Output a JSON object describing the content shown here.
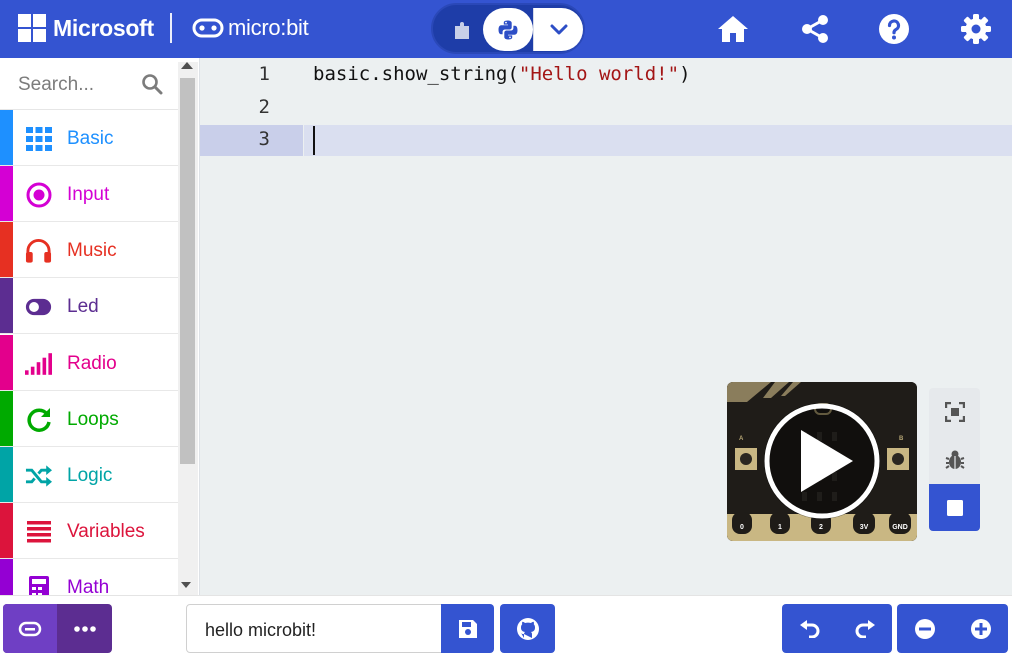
{
  "header": {
    "brand": "Microsoft",
    "product": "micro:bit",
    "mode_icons": [
      "puzzle-icon",
      "python-icon",
      "chevron-down-icon"
    ],
    "action_icons": [
      "home-icon",
      "share-icon",
      "help-icon",
      "gear-icon"
    ],
    "colors": {
      "bar": "#3454d1",
      "switch": "#1e3da8"
    }
  },
  "sidebar": {
    "search_placeholder": "Search...",
    "categories": [
      {
        "label": "Basic",
        "color": "#1e90ff",
        "icon": "grid-icon"
      },
      {
        "label": "Input",
        "color": "#d400d4",
        "icon": "target-icon"
      },
      {
        "label": "Music",
        "color": "#e63022",
        "icon": "headphones-icon"
      },
      {
        "label": "Led",
        "color": "#5c2d91",
        "icon": "toggle-icon"
      },
      {
        "label": "Radio",
        "color": "#e3008c",
        "icon": "signal-bars-icon"
      },
      {
        "label": "Loops",
        "color": "#00aa00",
        "icon": "refresh-icon"
      },
      {
        "label": "Logic",
        "color": "#00a4a6",
        "icon": "shuffle-icon"
      },
      {
        "label": "Variables",
        "color": "#dc143c",
        "icon": "list-icon"
      },
      {
        "label": "Math",
        "color": "#9400d3",
        "icon": "calculator-icon"
      }
    ]
  },
  "editor": {
    "line_numbers": [
      "1",
      "2",
      "3"
    ],
    "code": {
      "line1_call": "basic.show_string(",
      "line1_string": "\"Hello world!\"",
      "line1_close": ")",
      "line2": "",
      "line3": ""
    },
    "active_line": 3
  },
  "simulator": {
    "pin_labels": [
      "0",
      "1",
      "2",
      "3V",
      "GND"
    ],
    "button_labels": [
      "A",
      "B"
    ],
    "side_icons": [
      "fullscreen-icon",
      "bug-icon",
      "stop-icon"
    ]
  },
  "footer": {
    "project_name": "hello microbit!",
    "icons": [
      "device-icon",
      "more-icon",
      "save-icon",
      "github-icon",
      "undo-icon",
      "redo-icon",
      "zoom-out-icon",
      "zoom-in-icon"
    ]
  }
}
